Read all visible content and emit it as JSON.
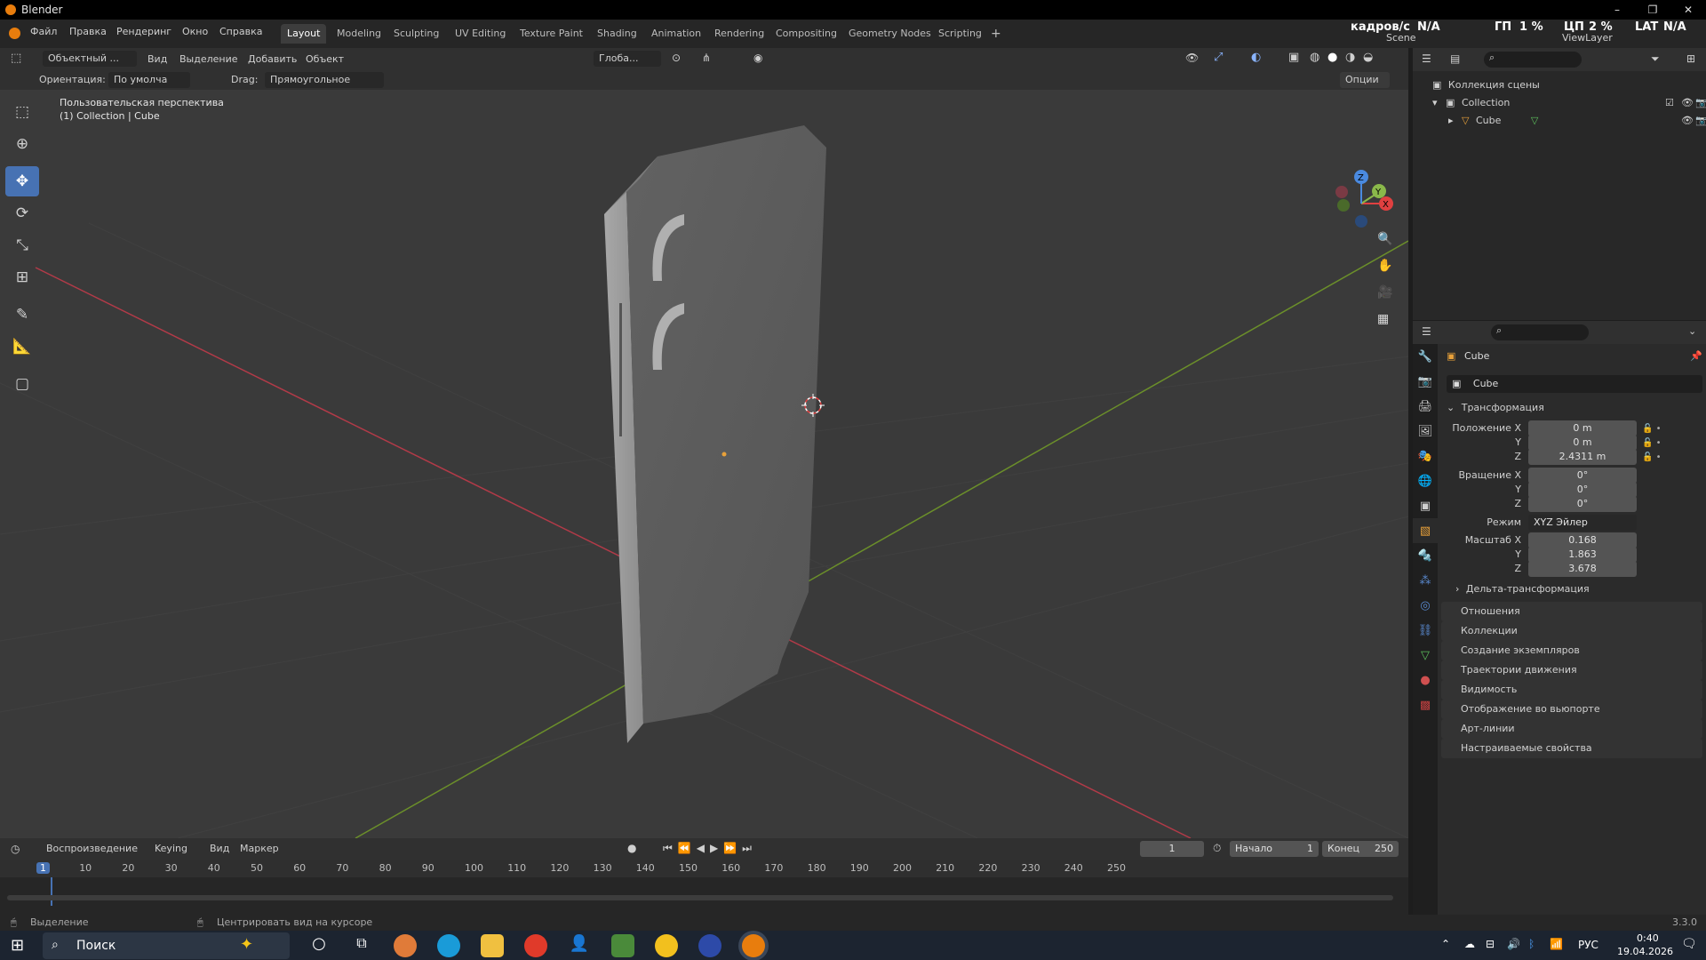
{
  "window": {
    "title": "Blender",
    "controls": [
      "–",
      "❐",
      "✕"
    ]
  },
  "menu": {
    "items": [
      "Файл",
      "Правка",
      "Рендеринг",
      "Окно",
      "Справка"
    ]
  },
  "workspaces": [
    "Layout",
    "Modeling",
    "Sculpting",
    "UV Editing",
    "Texture Paint",
    "Shading",
    "Animation",
    "Rendering",
    "Compositing",
    "Geometry Nodes",
    "Scripting"
  ],
  "add_workspace": "+",
  "topright": {
    "fps_label": "кадров/с",
    "fps_val": "N/A",
    "gpu_label": "ГП",
    "gpu_val": "1 %",
    "cpu_label": "ЦП",
    "cpu_val": "2 %",
    "lat_label": "LAT",
    "lat_val": "N/A",
    "scene": "Scene",
    "viewlayer": "ViewLayer"
  },
  "viewport_header": {
    "mode": "Объектный ...",
    "menus": [
      "Вид",
      "Выделение",
      "Добавить",
      "Объект"
    ],
    "transform_orientation": "Глоба...",
    "options": "Опции"
  },
  "tool_settings": {
    "orientation_label": "Ориентация:",
    "orientation_val": "По умолча",
    "drag_label": "Drag:",
    "drag_val": "Прямоугольное выд..."
  },
  "viewport": {
    "view_name": "Пользовательская перспектива",
    "collection_info": "(1) Collection | Cube",
    "gizmo_axes": [
      "X",
      "Y",
      "Z"
    ]
  },
  "outliner": {
    "root": "Коллекция сцены",
    "collection": "Collection",
    "object": "Cube"
  },
  "properties": {
    "object_name": "Cube",
    "datablock": "Cube",
    "transform_title": "Трансформация",
    "location_label": "Положение X",
    "location": [
      "0 m",
      "0 m",
      "2.4311 m"
    ],
    "rotation_label": "Вращение X",
    "rotation": [
      "0°",
      "0°",
      "0°"
    ],
    "mode_label": "Режим",
    "mode_val": "XYZ Эйлер",
    "scale_label": "Масштаб X",
    "scale": [
      "0.168",
      "1.863",
      "3.678"
    ],
    "axis_y": "Y",
    "axis_z": "Z",
    "delta": "Дельта-трансформация",
    "sections": [
      "Отношения",
      "Коллекции",
      "Создание экземпляров",
      "Траектории движения",
      "Видимость",
      "Отображение во вьюпорте",
      "Арт-линии",
      "Настраиваемые свойства"
    ]
  },
  "timeline": {
    "menus": [
      "Воспроизведение",
      "Keying",
      "Вид",
      "Маркер"
    ],
    "current_frame": "1",
    "start_label": "Начало",
    "start": "1",
    "end_label": "Конец",
    "end": "250",
    "ruler": [
      "1",
      "10",
      "20",
      "30",
      "40",
      "50",
      "60",
      "70",
      "80",
      "90",
      "100",
      "110",
      "120",
      "130",
      "140",
      "150",
      "160",
      "170",
      "180",
      "190",
      "200",
      "210",
      "220",
      "230",
      "240",
      "250"
    ]
  },
  "status": {
    "left": "Выделение",
    "middle": "Центрировать вид на курсоре",
    "version": "3.3.0"
  },
  "taskbar": {
    "search": "Поиск",
    "lang": "РУС",
    "time": "0:40",
    "date": "19.04.2026"
  }
}
